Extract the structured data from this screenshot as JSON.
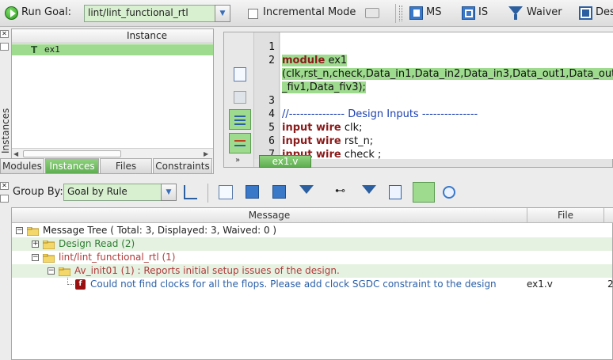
{
  "toolbar": {
    "run_goal_label": "Run Goal:",
    "goal_value": "lint/lint_functional_rtl",
    "incremental_label": "Incremental Mode",
    "ms_label": "MS",
    "is_label": "IS",
    "waiver_label": "Waiver",
    "design_label": "Des"
  },
  "left_panel": {
    "column_header": "Instance",
    "side_label": "Instances",
    "rows": [
      {
        "label": "ex1"
      }
    ],
    "tabs": [
      {
        "label": "Modules",
        "active": false
      },
      {
        "label": "Instances",
        "active": true
      },
      {
        "label": "Files",
        "active": false
      },
      {
        "label": "Constraints",
        "active": false
      }
    ]
  },
  "editor": {
    "file_tab": "ex1.v",
    "lines": [
      {
        "num": "1",
        "text": ""
      },
      {
        "num": "2",
        "kw": "module",
        "text": " ex1"
      },
      {
        "num": "",
        "text": "(clk,rst_n,check,Data_in1,Data_in2,Data_in3,Data_out1,Data_out"
      },
      {
        "num": "",
        "text": "_fiv1,Data_fiv3);"
      },
      {
        "num": "3",
        "text": ""
      },
      {
        "num": "4",
        "text": "//--------------- Design Inputs ---------------"
      },
      {
        "num": "5",
        "kw": "input wire",
        "text": " clk;"
      },
      {
        "num": "6",
        "kw": "input wire",
        "text": " rst_n;"
      },
      {
        "num": "7",
        "kw": "input wire",
        "text": " check ;"
      }
    ]
  },
  "group_by": {
    "label": "Group By:",
    "value": "Goal by Rule"
  },
  "messages": {
    "columns": [
      "Message",
      "File"
    ],
    "rows": [
      {
        "text": "Message Tree ( Total: 3, Displayed: 3, Waived: 0 )",
        "file": "",
        "line": ""
      },
      {
        "text": "Design Read (2)",
        "file": "",
        "line": ""
      },
      {
        "text": "lint/lint_functional_rtl (1)",
        "file": "",
        "line": ""
      },
      {
        "text": "Av_init01 (1) : Reports initial setup issues of the design.",
        "file": "",
        "line": ""
      },
      {
        "text": "Could not find clocks for all the flops. Please add clock SGDC constraint to the design",
        "file": "ex1.v",
        "line": "2",
        "badge": "f"
      }
    ]
  },
  "colors": {
    "accent_green": "#9fdb8f",
    "tab_green": "#5fae52",
    "keyword": "#8b1a1a",
    "comment": "#1a3fb0",
    "design_read": "#2e7d32",
    "goal_row": "#b03a3a",
    "rule_row": "#b03a3a",
    "message_link": "#2a5fa8"
  }
}
